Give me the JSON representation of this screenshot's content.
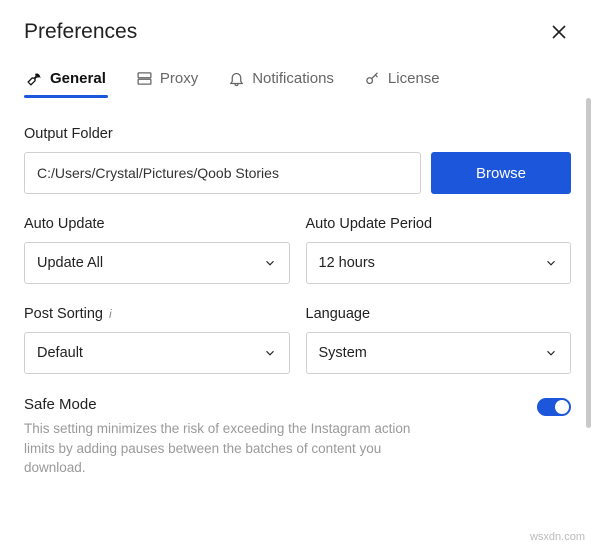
{
  "title": "Preferences",
  "tabs": {
    "general": "General",
    "proxy": "Proxy",
    "notifications": "Notifications",
    "license": "License"
  },
  "outputFolder": {
    "label": "Output Folder",
    "value": "C:/Users/Crystal/Pictures/Qoob Stories",
    "browse": "Browse"
  },
  "autoUpdate": {
    "label": "Auto Update",
    "value": "Update All"
  },
  "autoUpdatePeriod": {
    "label": "Auto Update Period",
    "value": "12 hours"
  },
  "postSorting": {
    "label": "Post Sorting",
    "value": "Default"
  },
  "language": {
    "label": "Language",
    "value": "System"
  },
  "safeMode": {
    "label": "Safe Mode",
    "desc": "This setting minimizes the risk of exceeding the Instagram action limits by adding pauses between the batches of content you download."
  },
  "watermark": "wsxdn.com"
}
